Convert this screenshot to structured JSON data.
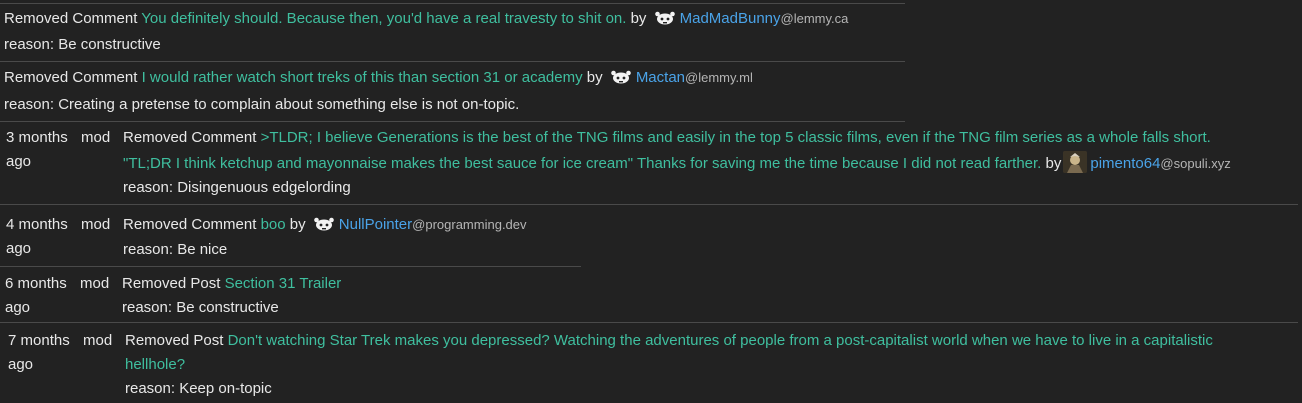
{
  "entries": [
    {
      "time": "",
      "time2": "",
      "mod": "",
      "action": "Removed Comment",
      "content": "You definitely should. Because then, you'd have a real travesty to shit on.",
      "by": "by",
      "user": "MadMadBunny",
      "domain": "@lemmy.ca",
      "reason": "reason: Be constructive"
    },
    {
      "time": "",
      "time2": "",
      "mod": "",
      "action": "Removed Comment",
      "content": "I would rather watch short treks of this than section 31 or academy",
      "by": "by",
      "user": "Mactan",
      "domain": "@lemmy.ml",
      "reason": "reason: Creating a pretense to complain about something else is not on-topic."
    },
    {
      "time": "3 months",
      "time2": "ago",
      "mod": "mod",
      "action": "Removed Comment",
      "content": ">TLDR; I believe Generations is the best of the TNG films and easily in the top 5 classic films, even if the TNG film series as a whole falls short.",
      "content2": "\"TL;DR I think ketchup and mayonnaise makes the best sauce for ice cream\" Thanks for saving me the time because I did not read farther.",
      "by": "by",
      "user": "pimento64",
      "domain": "@sopuli.xyz",
      "reason": "reason: Disingenuous edgelording"
    },
    {
      "time": "4 months",
      "time2": "ago",
      "mod": "mod",
      "action": "Removed Comment",
      "content": "boo",
      "by": "by",
      "user": "NullPointer",
      "domain": "@programming.dev",
      "reason": "reason: Be nice"
    },
    {
      "time": "6 months",
      "time2": "ago",
      "mod": "mod",
      "action": "Removed Post",
      "content": "Section 31 Trailer",
      "reason": "reason: Be constructive"
    },
    {
      "time": "7 months",
      "time2": "ago",
      "mod": "mod",
      "action": "Removed Post",
      "content": "Don't watching Star Trek makes you depressed? Watching the adventures of people from a post-capitalist world when we have to live in a capitalistic",
      "content2": "hellhole?",
      "reason": "reason: Keep on-topic"
    }
  ],
  "icons": {
    "default_avatar": "lemmy-default-avatar-icon",
    "custom_avatar": "user-avatar-icon"
  },
  "colors": {
    "background": "#222222",
    "link_content": "#3fbf9f",
    "link_user": "#4aa3e8",
    "text": "#e8e8e8"
  }
}
